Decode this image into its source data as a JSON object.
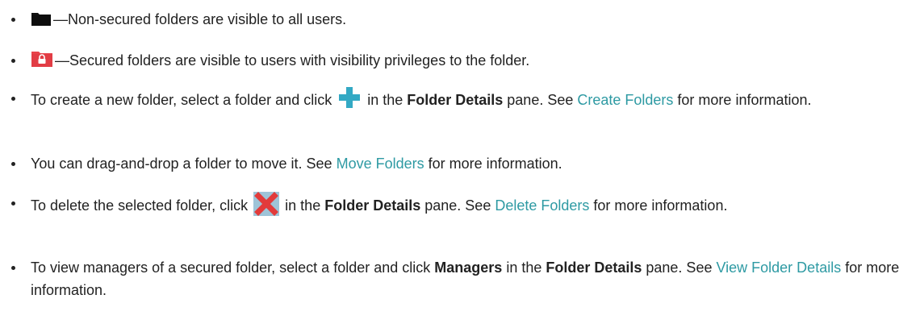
{
  "icons": {
    "folder": "folder-icon",
    "secured_folder": "secured-folder-icon",
    "add": "plus-icon",
    "delete": "delete-x-icon"
  },
  "colors": {
    "text": "#222222",
    "link": "#2e9aa3",
    "folder": "#111111",
    "secured_folder": "#e8434a",
    "plus": "#33a9c4",
    "delete": "#e23b3b"
  },
  "items": [
    {
      "text_after_icon": "—Non-secured folders are visible to all users."
    },
    {
      "text_after_icon": "—Secured folders are visible to users with visibility privileges to the folder."
    },
    {
      "text_before_icon": "To create a new folder, select a folder and click ",
      "text_after_icon": " in the ",
      "bold": "Folder Details",
      "text_mid": " pane. See ",
      "link": "Create Folders",
      "text_end": " for more information."
    },
    {
      "text_before_link": "You can drag-and-drop a folder to move it. See ",
      "link": "Move Folders",
      "text_end": " for more information."
    },
    {
      "text_before_icon": "To delete the selected folder, click ",
      "text_after_icon": " in the ",
      "bold": "Folder Details",
      "text_mid": " pane. See ",
      "link": "Delete Folders",
      "text_end": " for more information."
    },
    {
      "text_start": "To view managers of a secured folder, select a folder and click ",
      "bold1": "Managers",
      "text_mid1": " in the ",
      "bold2": "Folder Details",
      "text_mid2": " pane. See ",
      "link": "View Folder Details",
      "text_end": " for more information."
    }
  ]
}
